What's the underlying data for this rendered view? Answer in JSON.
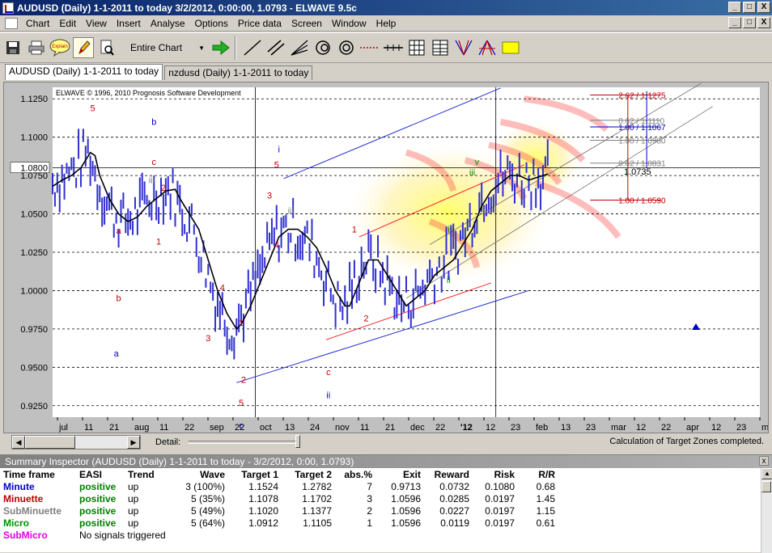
{
  "window": {
    "title": "AUDUSD (Daily)  1-1-2011 to today  3/2/2012, 0:00:00, 1.0793 - ELWAVE 9.5c",
    "minimize": "_",
    "maximize": "□",
    "close": "X"
  },
  "menu": {
    "items": [
      "Chart",
      "Edit",
      "View",
      "Insert",
      "Analyse",
      "Options",
      "Price data",
      "Screen",
      "Window",
      "Help"
    ]
  },
  "toolbar": {
    "explain_label": "Explain",
    "range_selected": "Entire Chart",
    "icons": [
      "save-icon",
      "print-icon",
      "explain-icon",
      "pencil-icon",
      "preview-icon",
      "go-arrow-icon",
      "line-tool-icon",
      "parallel-line-icon",
      "fan-line-icon",
      "spiral-icon",
      "circle-icon",
      "dotted-line-icon",
      "hline-icon",
      "grid-icon",
      "table-grid-icon",
      "fib-fan-icon",
      "fib-arc-icon",
      "rectangle-icon"
    ]
  },
  "tabs": [
    {
      "label": "AUDUSD (Daily)  1-1-2011 to today",
      "active": true
    },
    {
      "label": "nzdusd (Daily)  1-1-2011 to today",
      "active": false
    }
  ],
  "chart": {
    "copyright": "ELWAVE © 1996, 2010 Prognosis Software Development",
    "price_label": "1.0735",
    "last_price_axis_label": "1.0800"
  },
  "chart_data": {
    "type": "line",
    "ylim": [
      0.9175,
      1.1325
    ],
    "yticks": [
      "1.1250",
      "1.1000",
      "1.0750",
      "1.0500",
      "1.0250",
      "1.0000",
      "0.9750",
      "0.9500",
      "0.9250"
    ],
    "ytick_values": [
      1.125,
      1.1,
      1.075,
      1.05,
      1.025,
      1.0,
      0.975,
      0.95,
      0.925
    ],
    "xticks": [
      "jul",
      "11",
      "21",
      "aug",
      "11",
      "22",
      "sep",
      "22",
      "oct",
      "13",
      "24",
      "nov",
      "11",
      "21",
      "dec",
      "22",
      "'12",
      "12",
      "23",
      "feb",
      "13",
      "23",
      "mar",
      "12",
      "22",
      "apr",
      "12",
      "23",
      "m"
    ],
    "series": [
      {
        "color": "#000000",
        "points": [
          [
            0,
            1.068
          ],
          [
            4,
            1.072
          ],
          [
            8,
            1.075
          ],
          [
            12,
            1.08
          ],
          [
            16,
            1.09
          ],
          [
            18,
            1.088
          ],
          [
            20,
            1.075
          ],
          [
            24,
            1.06
          ],
          [
            28,
            1.05
          ],
          [
            32,
            1.045
          ],
          [
            36,
            1.048
          ],
          [
            40,
            1.055
          ],
          [
            44,
            1.06
          ],
          [
            48,
            1.065
          ],
          [
            52,
            1.066
          ],
          [
            54,
            1.06
          ],
          [
            58,
            1.05
          ],
          [
            62,
            1.04
          ],
          [
            66,
            1.02
          ],
          [
            70,
            1.0
          ],
          [
            74,
            0.985
          ],
          [
            78,
            0.975
          ],
          [
            80,
            0.978
          ],
          [
            84,
            0.99
          ],
          [
            88,
            1.005
          ],
          [
            92,
            1.02
          ],
          [
            96,
            1.035
          ],
          [
            100,
            1.04
          ],
          [
            104,
            1.04
          ],
          [
            108,
            1.035
          ],
          [
            112,
            1.028
          ],
          [
            116,
            1.015
          ],
          [
            120,
            1.0
          ],
          [
            124,
            0.99
          ],
          [
            126,
            0.99
          ],
          [
            130,
            1.005
          ],
          [
            134,
            1.02
          ],
          [
            138,
            1.02
          ],
          [
            142,
            1.01
          ],
          [
            146,
            1.0
          ],
          [
            150,
            0.99
          ],
          [
            154,
            0.995
          ],
          [
            158,
            1.0
          ],
          [
            162,
            1.01
          ],
          [
            166,
            1.015
          ],
          [
            170,
            1.02
          ],
          [
            174,
            1.03
          ],
          [
            178,
            1.04
          ],
          [
            182,
            1.055
          ],
          [
            186,
            1.065
          ],
          [
            190,
            1.07
          ],
          [
            194,
            1.075
          ],
          [
            198,
            1.075
          ],
          [
            202,
            1.072
          ],
          [
            206,
            1.074
          ],
          [
            210,
            1.076
          ]
        ]
      }
    ],
    "wave_labels": [
      {
        "text": "5",
        "x": 17,
        "y": 1.117,
        "color": "#c00000"
      },
      {
        "text": "b",
        "x": 43,
        "y": 1.108,
        "color": "#0000c0"
      },
      {
        "text": "c",
        "x": 43,
        "y": 1.082,
        "color": "#c00000"
      },
      {
        "text": "iii",
        "x": 42,
        "y": 1.07,
        "color": "#808080"
      },
      {
        "text": "2",
        "x": 47,
        "y": 1.065,
        "color": "#c00000"
      },
      {
        "text": "a",
        "x": 28,
        "y": 1.037,
        "color": "#c00000"
      },
      {
        "text": "1",
        "x": 45,
        "y": 1.03,
        "color": "#c00000"
      },
      {
        "text": "b",
        "x": 28,
        "y": 0.993,
        "color": "#c00000"
      },
      {
        "text": "a",
        "x": 27,
        "y": 0.957,
        "color": "#0000c0"
      },
      {
        "text": "3",
        "x": 66,
        "y": 0.967,
        "color": "#c00000"
      },
      {
        "text": "4",
        "x": 72,
        "y": 1.0,
        "color": "#c00000"
      },
      {
        "text": "1",
        "x": 80,
        "y": 0.977,
        "color": "#c00000"
      },
      {
        "text": "2",
        "x": 81,
        "y": 0.94,
        "color": "#c00000"
      },
      {
        "text": "5",
        "x": 80,
        "y": 0.925,
        "color": "#c00000"
      },
      {
        "text": "c",
        "x": 80,
        "y": 0.91,
        "color": "#0000c0"
      },
      {
        "text": "i",
        "x": 96,
        "y": 1.09,
        "color": "#0000c0"
      },
      {
        "text": "5",
        "x": 95,
        "y": 1.08,
        "color": "#c00000"
      },
      {
        "text": "3",
        "x": 92,
        "y": 1.06,
        "color": "#c00000"
      },
      {
        "text": "4",
        "x": 95,
        "y": 1.028,
        "color": "#c00000"
      },
      {
        "text": "iii",
        "x": 101,
        "y": 1.05,
        "color": "#808080"
      },
      {
        "text": "1",
        "x": 128,
        "y": 1.038,
        "color": "#c00000"
      },
      {
        "text": "2",
        "x": 133,
        "y": 0.98,
        "color": "#c00000"
      },
      {
        "text": "c",
        "x": 117,
        "y": 0.945,
        "color": "#c00000"
      },
      {
        "text": "ii",
        "x": 117,
        "y": 0.93,
        "color": "#0000c0"
      },
      {
        "text": "iii",
        "x": 178,
        "y": 1.075,
        "color": "#009000"
      },
      {
        "text": "v",
        "x": 180,
        "y": 1.082,
        "color": "#009000"
      },
      {
        "text": "iv",
        "x": 184,
        "y": 1.05,
        "color": "#808080"
      },
      {
        "text": "i",
        "x": 168,
        "y": 1.038,
        "color": "#009000"
      },
      {
        "text": "ii",
        "x": 168,
        "y": 1.005,
        "color": "#009000"
      }
    ],
    "target_levels": [
      {
        "label": "2.62 / 1.1275",
        "value": 1.1275,
        "color": "#c00000"
      },
      {
        "label": "1.00 / 1.1067",
        "value": 1.1067,
        "color": "#0000c0"
      },
      {
        "label": "0.62 / 1.1110",
        "value": 1.111,
        "color": "#808080"
      },
      {
        "label": "1.00 / 1.0980",
        "value": 1.098,
        "color": "#808080"
      },
      {
        "label": "0.62 / 1.0831",
        "value": 1.0831,
        "color": "#808080"
      },
      {
        "label": "1.00 / 1.0590",
        "value": 1.059,
        "color": "#c00000"
      }
    ]
  },
  "scrollbar": {
    "detail_label": "Detail:",
    "status": "Calculation of Target Zones completed."
  },
  "inspector": {
    "title": "Summary Inspector (AUDUSD (Daily)  1-1-2011 to today - 3/2/2012, 0:00, 1.0793)",
    "columns": [
      "Time frame",
      "EASI",
      "Trend",
      "Wave",
      "Target 1",
      "Target 2",
      "abs.%",
      "Exit",
      "Reward",
      "Risk",
      "R/R"
    ],
    "rows": [
      {
        "timeframe": "Minute",
        "tf_color": "#0000c0",
        "easi": "positive",
        "trend": "up",
        "wave": "3 (100%)",
        "t1": "1.1524",
        "t2": "1.2782",
        "abs": "7",
        "exit": "0.9713",
        "reward": "0.0732",
        "risk": "0.1080",
        "rr": "0.68"
      },
      {
        "timeframe": "Minuette",
        "tf_color": "#c00000",
        "easi": "positive",
        "trend": "up",
        "wave": "5 (35%)",
        "t1": "1.1078",
        "t2": "1.1702",
        "abs": "3",
        "exit": "1.0596",
        "reward": "0.0285",
        "risk": "0.0197",
        "rr": "1.45"
      },
      {
        "timeframe": "SubMinuette",
        "tf_color": "#808080",
        "easi": "positive",
        "trend": "up",
        "wave": "5 (49%)",
        "t1": "1.1020",
        "t2": "1.1377",
        "abs": "2",
        "exit": "1.0596",
        "reward": "0.0227",
        "risk": "0.0197",
        "rr": "1.15"
      },
      {
        "timeframe": "Micro",
        "tf_color": "#009000",
        "easi": "positive",
        "trend": "up",
        "wave": "5 (64%)",
        "t1": "1.0912",
        "t2": "1.1105",
        "abs": "1",
        "exit": "1.0596",
        "reward": "0.0119",
        "risk": "0.0197",
        "rr": "0.61"
      }
    ],
    "last_row": {
      "timeframe": "SubMicro",
      "tf_color": "#e000e0",
      "message": "No signals triggered"
    }
  }
}
